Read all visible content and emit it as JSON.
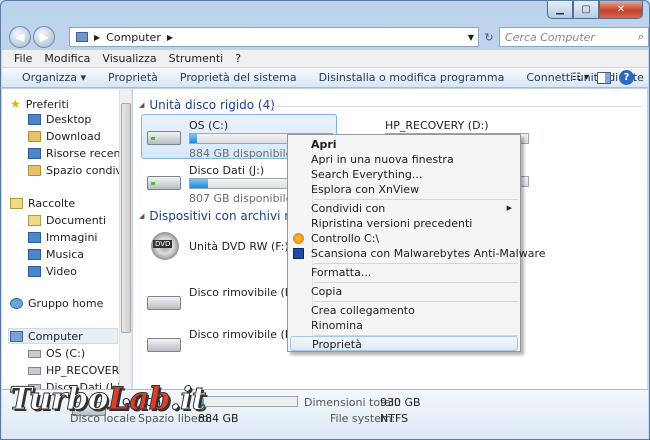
{
  "address": {
    "path": "Computer",
    "search_placeholder": "Cerca Computer"
  },
  "menubar": [
    "File",
    "Modifica",
    "Visualizza",
    "Strumenti",
    "?"
  ],
  "toolbar": [
    "Organizza ▾",
    "Proprietà",
    "Proprietà del sistema",
    "Disinstalla o modifica programma",
    "Connetti unità di rete",
    "»"
  ],
  "sidebar": {
    "favorites_title": "Preferiti",
    "favorites": [
      "Desktop",
      "Download",
      "Risorse recenti",
      "Spazio condiviso"
    ],
    "libraries_title": "Raccolte",
    "libraries": [
      "Documenti",
      "Immagini",
      "Musica",
      "Video"
    ],
    "homegroup": "Gruppo home",
    "computer_title": "Computer",
    "computer_items": [
      "OS (C:)",
      "HP_RECOVERY (D",
      "Disco Dati (J:)"
    ]
  },
  "content": {
    "hdd_group": "Unità disco rigido (4)",
    "removable_group": "Dispositivi con archivi rimov",
    "drives": [
      {
        "name": "OS (C:)",
        "free": "884 GB disponibile su 93",
        "used_fraction": 0.05
      },
      {
        "name": "HP_RECOVERY (D:)",
        "free": "",
        "used_fraction": 0.95
      },
      {
        "name": "Disco Dati (J:)",
        "free": "807 GB disponibile su 93",
        "used_fraction": 0.13
      },
      {
        "name": "",
        "free": "",
        "used_fraction": 0.0
      }
    ],
    "removable": [
      "Unità DVD RW (F:)",
      "Disco rimovibile (H:)",
      "Disco rimovibile (K:)"
    ],
    "dvd_label": "DVD"
  },
  "context_menu": [
    {
      "label": "Apri",
      "bold": true
    },
    {
      "label": "Apri in una nuova finestra"
    },
    {
      "label": "Search Everything..."
    },
    {
      "label": "Esplora con XnView"
    },
    {
      "label": "Condividi con",
      "submenu": true
    },
    {
      "label": "Ripristina versioni precedenti"
    },
    {
      "label": "Controllo C:\\"
    },
    {
      "label": "Scansiona con Malwarebytes Anti-Malware"
    },
    {
      "label": "Formatta..."
    },
    {
      "label": "Copia"
    },
    {
      "label": "Crea collegamento"
    },
    {
      "label": "Rinomina"
    },
    {
      "label": "Proprietà",
      "highlighted": true
    }
  ],
  "details": {
    "name": "OS (C:)",
    "type": "Disco locale",
    "free_label": "Spazio libero:",
    "free_value": "884 GB",
    "total_label": "Dimensioni totali:",
    "total_value": "930 GB",
    "fs_label": "File system:",
    "fs_value": "NTFS"
  },
  "watermark": {
    "part1": "Turbo",
    "part2": "Lab",
    "part3": ".it"
  },
  "colors": {
    "accent": "#1e3f8a",
    "bar_fill": "#1e8ad6",
    "highlight": "#dfeaf8",
    "watermark_red": "#e33b2a"
  }
}
